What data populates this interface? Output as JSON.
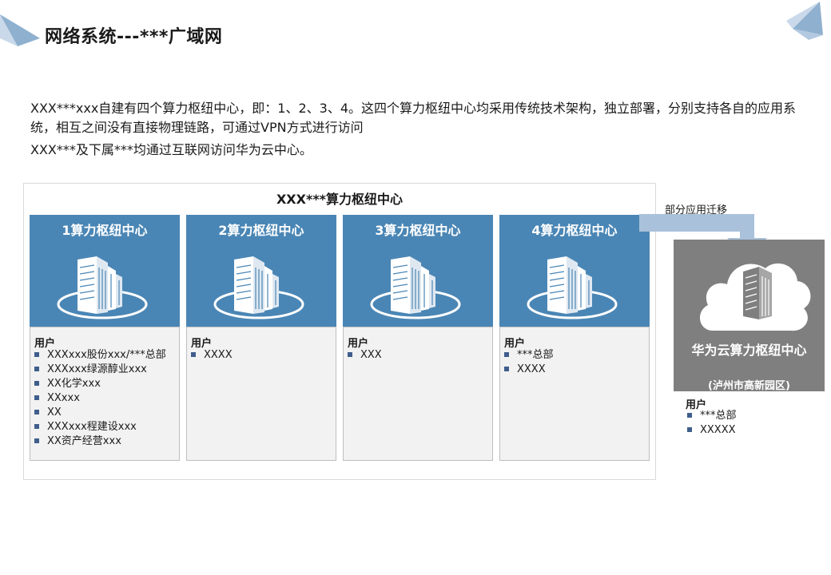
{
  "title": "网络系统---***广域网",
  "paragraphs": {
    "p1": "XXX***xxx自建有四个算力枢纽中心，即：1、2、3、4。这四个算力枢纽中心均采用传统技术架构，独立部署，分别支持各自的应用系统，相互之间没有直接物理链路，可通过VPN方式进行访问",
    "p2": "XXX***及下属***均通过互联网访问华为云中心。"
  },
  "group_title": "XXX***算力枢纽中心",
  "users_label": "用户",
  "centers": [
    {
      "label": "1算力枢纽中心",
      "users": [
        "XXXxxx股份xxx/***总部",
        "XXXxxx绿源醇业xxx",
        "XX化学xxx",
        "XXxxx",
        "XX",
        "XXXxxx程建设xxx",
        "XX资产经营xxx"
      ]
    },
    {
      "label": "2算力枢纽中心",
      "users": [
        "XXXX"
      ]
    },
    {
      "label": "3算力枢纽中心",
      "users": [
        "XXX"
      ]
    },
    {
      "label": "4算力枢纽中心",
      "users": [
        "***总部",
        "XXXX"
      ]
    }
  ],
  "migration_label": "部分应用迁移",
  "huawei": {
    "label": "华为云算力枢纽中心",
    "sub": "(泸州市高新园区)",
    "users": [
      "***总部",
      "XXXXX"
    ]
  },
  "colors": {
    "column_header": "#4a86b5",
    "column_body": "#f2f2f2",
    "huawei_box": "#7f7f7f",
    "arrow": "#a9c1da",
    "bullet": "#3f5e8c"
  }
}
